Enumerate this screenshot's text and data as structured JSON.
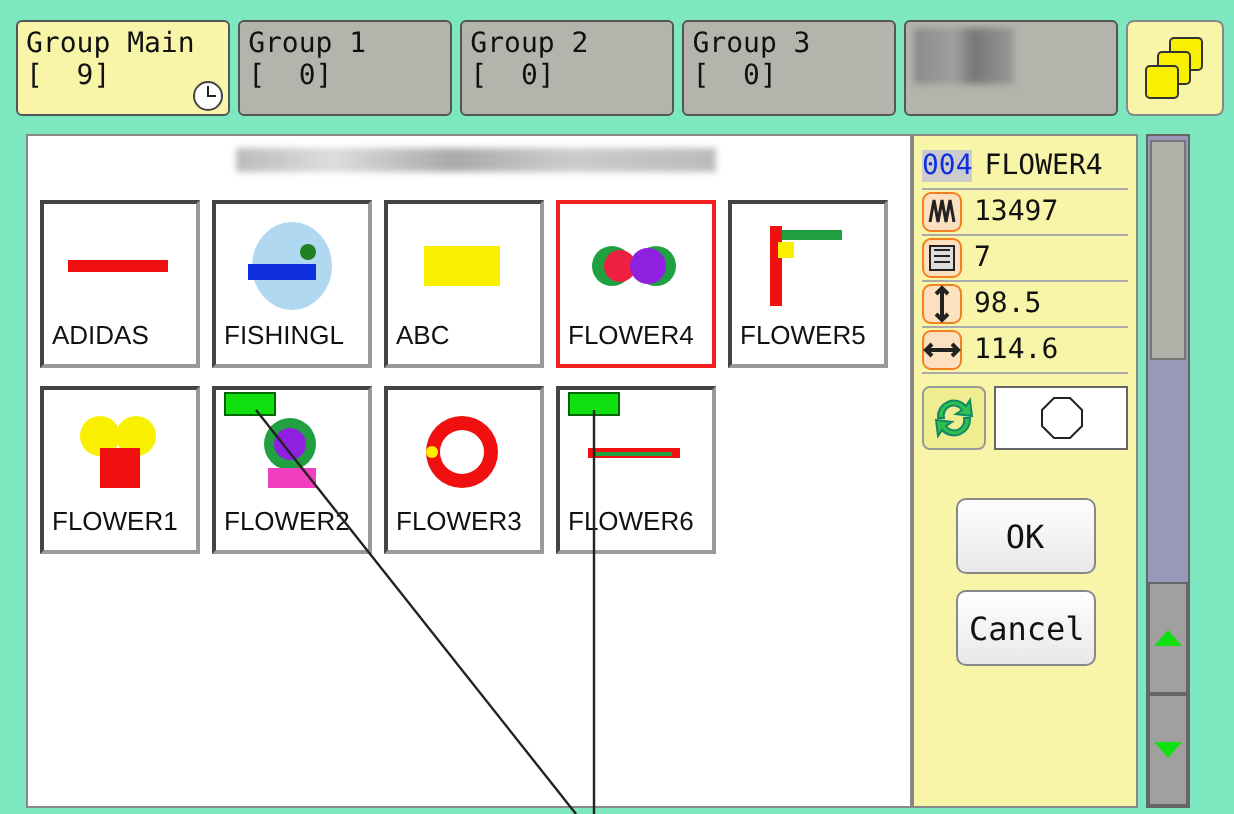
{
  "tabs": [
    {
      "label": "Group Main",
      "count": "[  9]",
      "selected": true,
      "clock": true
    },
    {
      "label": "Group 1",
      "count": "[  0]",
      "selected": false,
      "clock": false
    },
    {
      "label": "Group 2",
      "count": "[  0]",
      "selected": false,
      "clock": false
    },
    {
      "label": "Group 3",
      "count": "[  0]",
      "selected": false,
      "clock": false
    },
    {
      "redacted": true,
      "selected": false,
      "clock": false
    }
  ],
  "heading": {
    "redacted": true
  },
  "designs": [
    {
      "name": "ADIDAS",
      "selected": false,
      "marked": false
    },
    {
      "name": "FISHINGL",
      "selected": false,
      "marked": false
    },
    {
      "name": "ABC",
      "selected": false,
      "marked": false
    },
    {
      "name": "FLOWER4",
      "selected": true,
      "marked": false
    },
    {
      "name": "FLOWER5",
      "selected": false,
      "marked": false
    },
    {
      "name": "FLOWER1",
      "selected": false,
      "marked": false
    },
    {
      "name": "FLOWER2",
      "selected": false,
      "marked": true
    },
    {
      "name": "FLOWER3",
      "selected": false,
      "marked": false
    },
    {
      "name": "FLOWER6",
      "selected": false,
      "marked": true
    }
  ],
  "info": {
    "number": "004",
    "name": "FLOWER4",
    "rows": [
      {
        "kind": "stitches",
        "value": "13497"
      },
      {
        "kind": "colors",
        "value": "7"
      },
      {
        "kind": "height",
        "value": "98.5"
      },
      {
        "kind": "width",
        "value": "114.6"
      }
    ]
  },
  "frame": {
    "kind": "octagon"
  },
  "buttons": [
    "OK",
    "Cancel"
  ]
}
